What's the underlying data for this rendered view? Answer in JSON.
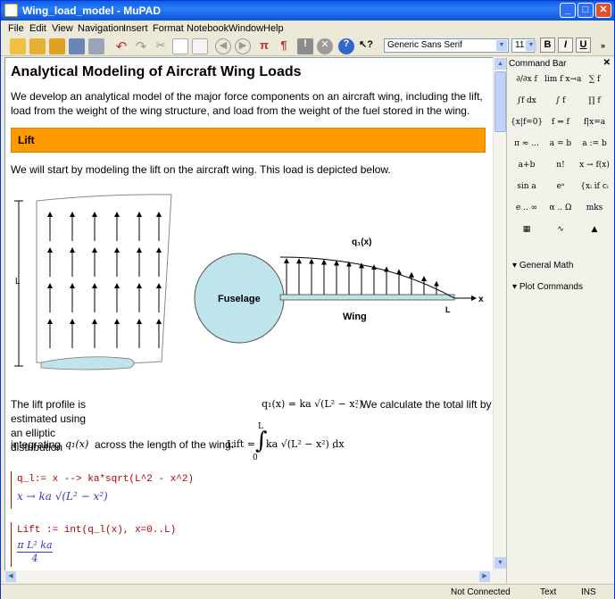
{
  "window": {
    "title": "Wing_load_model - MuPAD"
  },
  "menu": [
    "File",
    "Edit",
    "View",
    "Navigation",
    "Insert",
    "Format",
    "Notebook",
    "Window",
    "Help"
  ],
  "format": {
    "font": "Generic Sans Serif",
    "size": "11",
    "bold": "B",
    "italic": "I",
    "underline": "U"
  },
  "doc": {
    "title": "Analytical Modeling of Aircraft Wing Loads",
    "intro": "We develop an analytical model of the major force components on an aircraft wing, including the lift, load from the weight of the wing structure, and load from the weight of the fuel stored in the wing.",
    "section": "Lift",
    "lift_text": "We will start by modeling the lift on the aircraft wing.  This load is depicted below.",
    "figure": {
      "left_label": "L",
      "fuselage": "Fuselage",
      "wing": "Wing",
      "q_label": "q₁(x)",
      "x_label": "x",
      "tip_label": "L"
    },
    "profile_text_1": "The lift profile is estimated using an elliptic distribution",
    "profile_math": "q₁(x) = ka √(L² − x²)",
    "profile_text_2": ".  We calculate the total lift by",
    "integrate_text": "integrating",
    "integrate_math": "q₁(x)",
    "integrate_text_2": "across the length of the wing:",
    "lift_lhs": "Lift =",
    "lift_int": "ka √(L² − x²) dx",
    "lift_upper": "L",
    "lift_lower": "0",
    "cell1_input": "q_l:= x --> ka*sqrt(L^2 - x^2)",
    "cell1_output": "x → ka √(L² − x²)",
    "cell2_input": "Lift := int(q_l(x), x=0..L)",
    "cell2_output_num": "π L² ka",
    "cell2_output_den": "4"
  },
  "command_bar": {
    "title": "Command Bar",
    "buttons": [
      "∂/∂x f",
      "lim f x→a",
      "∑ f",
      "∫f dx",
      "∫ f",
      "∏ f",
      "{x|f=0}",
      "f ⇒ f",
      "f|x=a",
      "π ≈ ...",
      "a = b",
      "a := b",
      "a+b",
      "n!",
      "x → f(x)",
      "sin a",
      "eᵃ",
      "{xᵢ if cᵢ",
      "e .. ∞",
      "α .. Ω",
      "mks",
      "▦",
      "∿",
      "▲"
    ],
    "sections": [
      "General Math",
      "Plot Commands"
    ]
  },
  "status": {
    "connection": "Not Connected",
    "mode": "Text",
    "ins": "INS"
  }
}
